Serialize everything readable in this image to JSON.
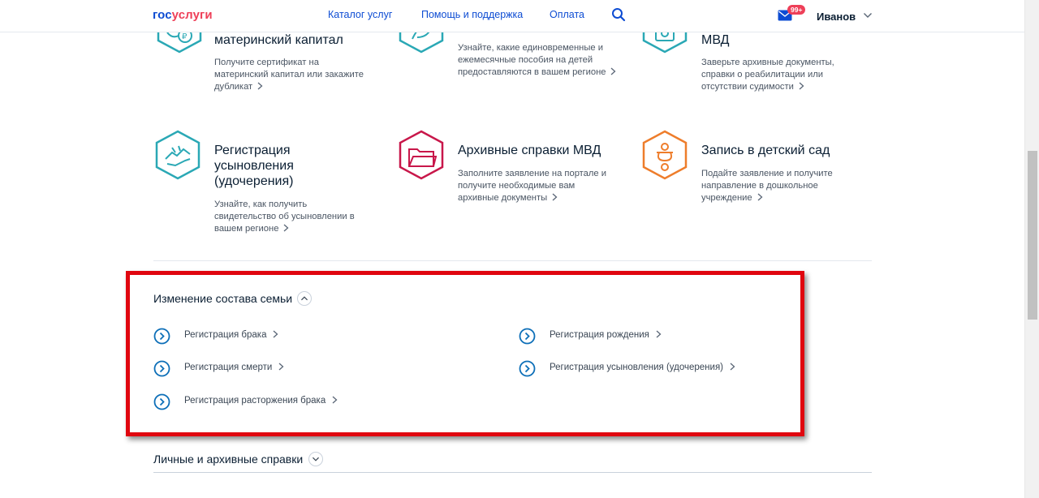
{
  "header": {
    "logo_part1": "гос",
    "logo_part2": "услуги",
    "nav": [
      "Каталог услуг",
      "Помощь и поддержка",
      "Оплата"
    ],
    "mail_badge": "99+",
    "user_name": "Иванов"
  },
  "cards_top": [
    {
      "title": "материнский капитал",
      "desc": [
        "Получите сертификат на",
        "материнский капитал или закажите",
        "дубликат"
      ],
      "icon": "maternity-capital-icon",
      "color": "#2aa8b5"
    },
    {
      "title": "",
      "desc": [
        "Узнайте, какие единовременные и",
        "ежемесячные пособия на детей",
        "предоставляются в вашем регионе"
      ],
      "icon": "child-benefits-icon",
      "color": "#2aa8b5"
    },
    {
      "title": "МВД",
      "desc": [
        "Заверьте архивные документы,",
        "справки о реабилитации или",
        "отсутствии судимости"
      ],
      "icon": "mvd-certificates-icon",
      "color": "#2aa8b5"
    }
  ],
  "cards_mid": [
    {
      "title_lines": [
        "Регистрация",
        "усыновления",
        "(удочерения)"
      ],
      "desc": [
        "Узнайте, как получить",
        "свидетельство об усыновлении в",
        "вашем регионе"
      ],
      "icon": "adoption-hands-icon",
      "color": "#2aa8b5"
    },
    {
      "title_lines": [
        "Архивные справки МВД"
      ],
      "desc": [
        "Заполните заявление на портале и",
        "получите необходимые вам",
        "архивные документы"
      ],
      "icon": "folder-icon",
      "color": "#c8174a"
    },
    {
      "title_lines": [
        "Запись в детский сад"
      ],
      "desc": [
        "Подайте заявление и получите",
        "направление в дошкольное",
        "учреждение"
      ],
      "icon": "pacifier-icon",
      "color": "#ee7d2b"
    }
  ],
  "family_section": {
    "title": "Изменение состава семьи",
    "left_links": [
      "Регистрация брака",
      "Регистрация смерти",
      "Регистрация расторжения брака"
    ],
    "right_links": [
      "Регистрация рождения",
      "Регистрация усыновления (удочерения)"
    ]
  },
  "personal_section": {
    "title": "Личные и архивные справки"
  },
  "colors": {
    "brand_blue": "#0d4cd3",
    "brand_red": "#ee3f58",
    "link_icon_blue": "#0d6fb8",
    "highlight_frame": "#e0060f"
  }
}
